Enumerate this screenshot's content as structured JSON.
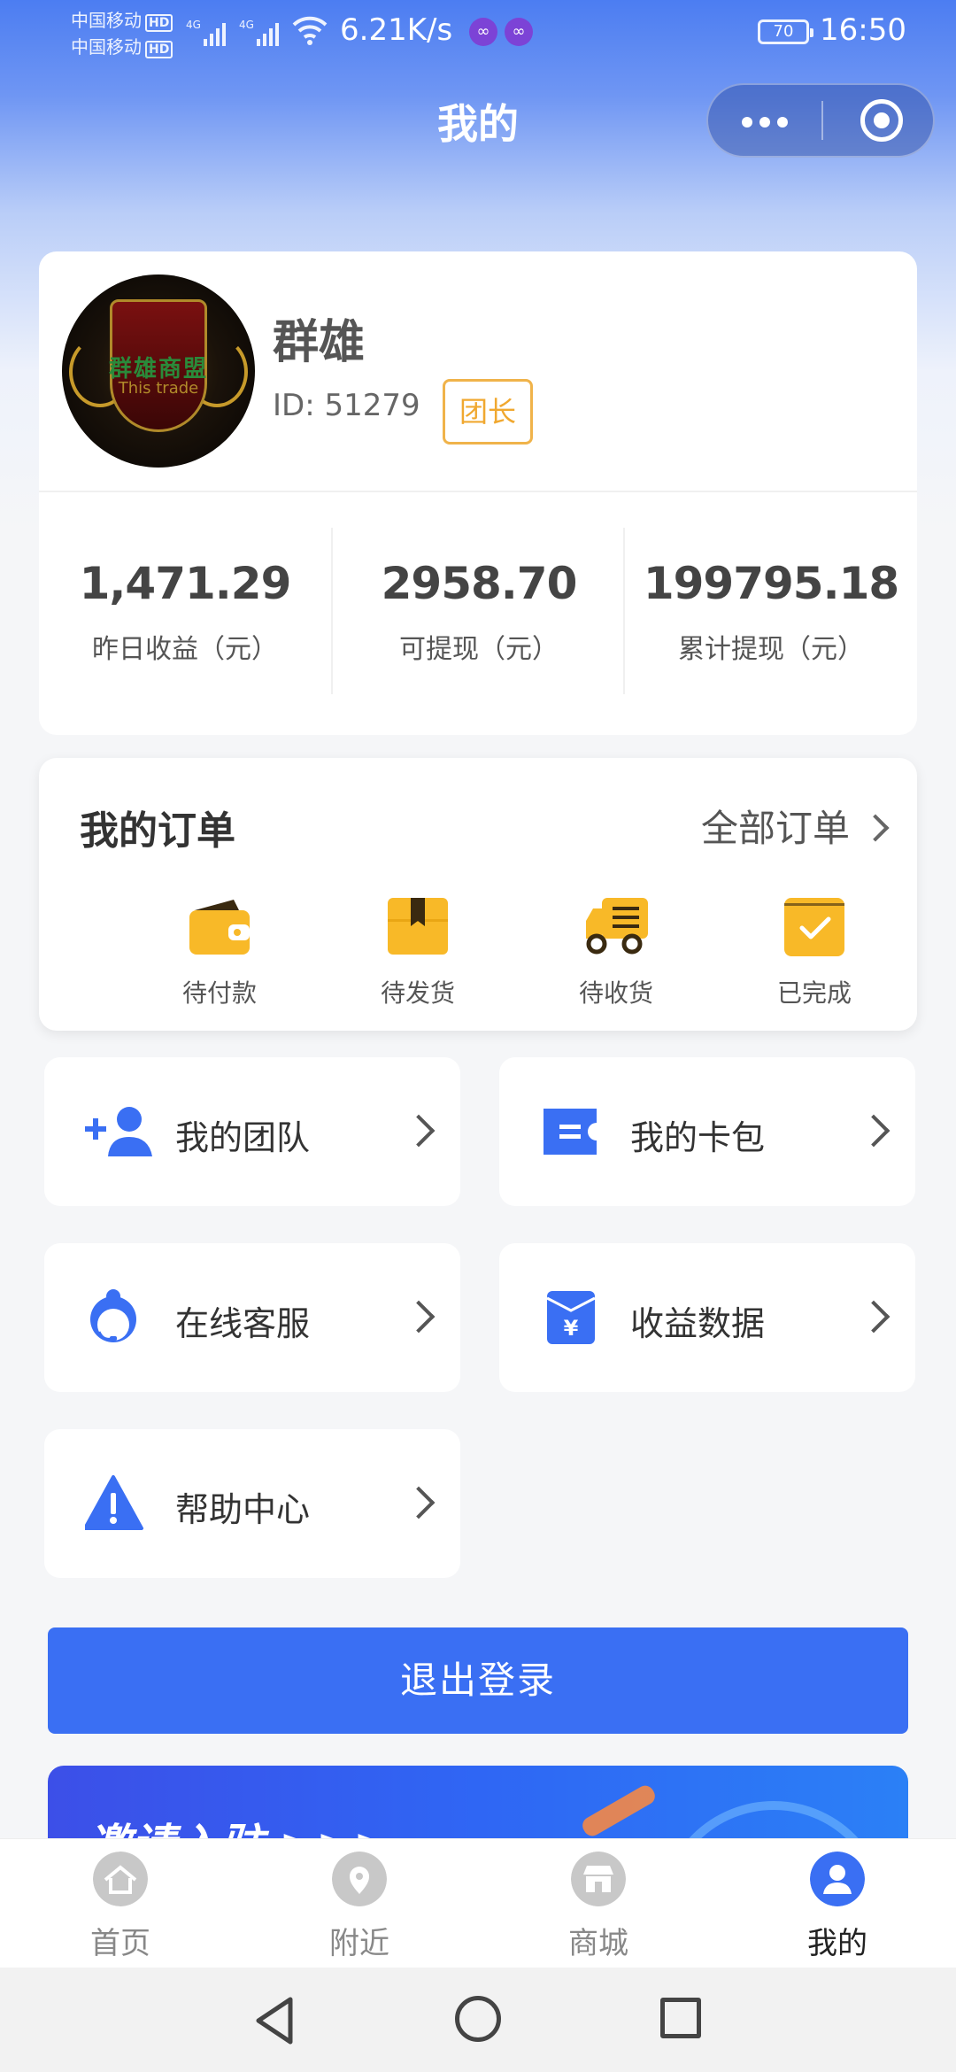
{
  "status_bar": {
    "carrier1": "中国移动",
    "carrier2": "中国移动",
    "hd": "HD",
    "network": "4G",
    "speed": "6.21K/s",
    "battery": "70",
    "time": "16:50"
  },
  "header": {
    "title": "我的"
  },
  "profile": {
    "name": "群雄",
    "id_label": "ID: 51279",
    "role": "团长",
    "avatar_text1": "群雄商盟",
    "avatar_text2": "This trade"
  },
  "stats": [
    {
      "value": "1,471.29",
      "label": "昨日收益（元）"
    },
    {
      "value": "2958.70",
      "label": "可提现（元）"
    },
    {
      "value": "199795.18",
      "label": "累计提现（元）"
    }
  ],
  "orders": {
    "title": "我的订单",
    "all_label": "全部订单",
    "items": [
      {
        "label": "待付款",
        "icon": "wallet-icon"
      },
      {
        "label": "待发货",
        "icon": "box-icon"
      },
      {
        "label": "待收货",
        "icon": "truck-icon"
      },
      {
        "label": "已完成",
        "icon": "check-icon"
      }
    ]
  },
  "menu": [
    {
      "label": "我的团队",
      "icon": "add-user-icon"
    },
    {
      "label": "我的卡包",
      "icon": "card-icon"
    },
    {
      "label": "在线客服",
      "icon": "customer-service-icon"
    },
    {
      "label": "收益数据",
      "icon": "yuan-icon"
    },
    {
      "label": "帮助中心",
      "icon": "warning-icon"
    }
  ],
  "logout_label": "退出登录",
  "banner_text": "邀请入驻 >>>",
  "tabs": [
    {
      "label": "首页",
      "icon": "home-icon"
    },
    {
      "label": "附近",
      "icon": "location-icon"
    },
    {
      "label": "商城",
      "icon": "store-icon"
    },
    {
      "label": "我的",
      "icon": "user-icon",
      "active": true
    }
  ],
  "colors": {
    "accent": "#3a6ff3",
    "order_icon": "#f8b928",
    "role_badge": "#f0a830"
  }
}
